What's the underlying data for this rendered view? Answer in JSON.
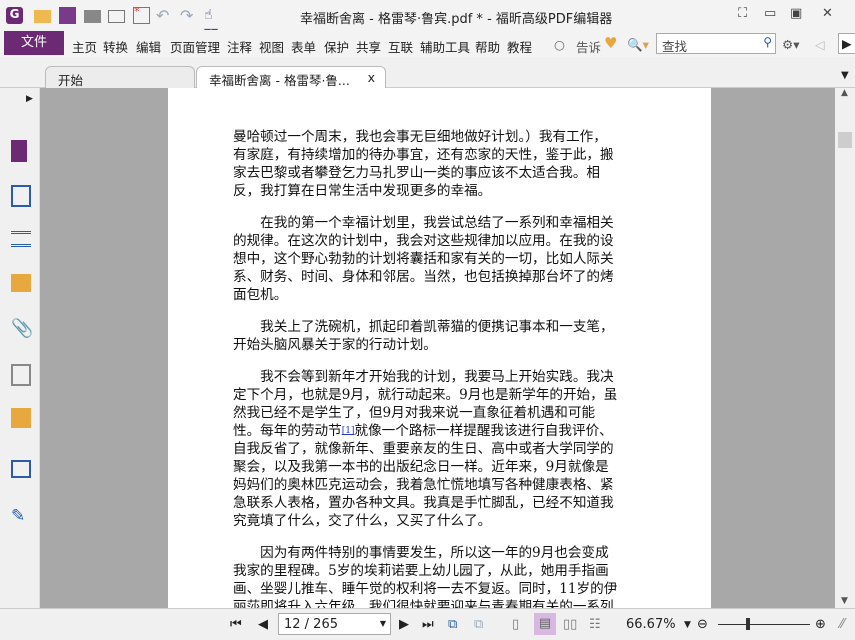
{
  "window": {
    "title": "幸福断舍离 - 格雷琴·鲁宾.pdf * - 福昕高级PDF编辑器"
  },
  "menu": {
    "file": "文件",
    "items": [
      "主页",
      "转换",
      "编辑",
      "页面管理",
      "注释",
      "视图",
      "表单",
      "保护",
      "共享",
      "互联",
      "辅助工具",
      "帮助",
      "教程"
    ],
    "tell": "告诉",
    "search_placeholder": "查找"
  },
  "tabs": [
    {
      "label": "开始"
    },
    {
      "label": "幸福断舍离 - 格雷琴·鲁...",
      "close": "x"
    }
  ],
  "document": {
    "paragraphs": [
      [
        "曼哈顿过一个周末，我也会事无巨细地做好计划。）我有工作，",
        "有家庭，有持续增加的待办事宜，还有恋家的天性，鉴于此，搬",
        "家去巴黎或者攀登乞力马扎罗山一类的事应该不太适合我。相",
        "反，我打算在日常生活中发现更多的幸福。"
      ],
      [
        "　　在我的第一个幸福计划里，我尝试总结了一系列和幸福相关",
        "的规律。在这次的计划中，我会对这些规律加以应用。在我的设",
        "想中，这个野心勃勃的计划将囊括和家有关的一切，比如人际关",
        "系、财务、时间、身体和邻居。当然，也包括换掉那台坏了的烤",
        "面包机。"
      ],
      [
        "　　我关上了洗碗机，抓起印着凯蒂猫的便携记事本和一支笔，",
        "开始头脑风暴关于家的行动计划。"
      ]
    ],
    "para4": {
      "before": [
        "　　我不会等到新年才开始我的计划，我要马上开始实践。我决",
        "定下个月，也就是9月，就行动起来。9月也是新学年的开始，虽",
        "然我已经不是学生了，但9月对我来说一直象征着机遇和可能"
      ],
      "fn_pre": "性。每年的劳动节",
      "footnote": "[1]",
      "fn_post": "就像一个路标一样提醒我该进行自我评价、",
      "after": [
        "自我反省了，就像新年、重要亲友的生日、高中或者大学同学的",
        "聚会，以及我第一本书的出版纪念日一样。近年来，9月就像是",
        "妈妈们的奥林匹克运动会，我着急忙慌地填写各种健康表格、紧",
        "急联系人表格，置办各种文具。我真是手忙脚乱，已经不知道我",
        "究竟填了什么，交了什么，又买了什么了。"
      ]
    },
    "para5": [
      "　　因为有两件特别的事情要发生，所以这一年的9月也会变成",
      "我家的里程碑。5岁的埃莉诺要上幼儿园了，从此，她用手指画",
      "画、坐婴儿推车、睡午觉的权利将一去不复返。同时，11岁的伊",
      "丽莎即将升入六年级，我们很快就要迎来与青春期有关的一系列"
    ]
  },
  "status": {
    "page": "12 / 265",
    "zoom": "66.67%",
    "zoom_fraction": 0.33
  },
  "colors": {
    "accent": "#6b2a73"
  }
}
